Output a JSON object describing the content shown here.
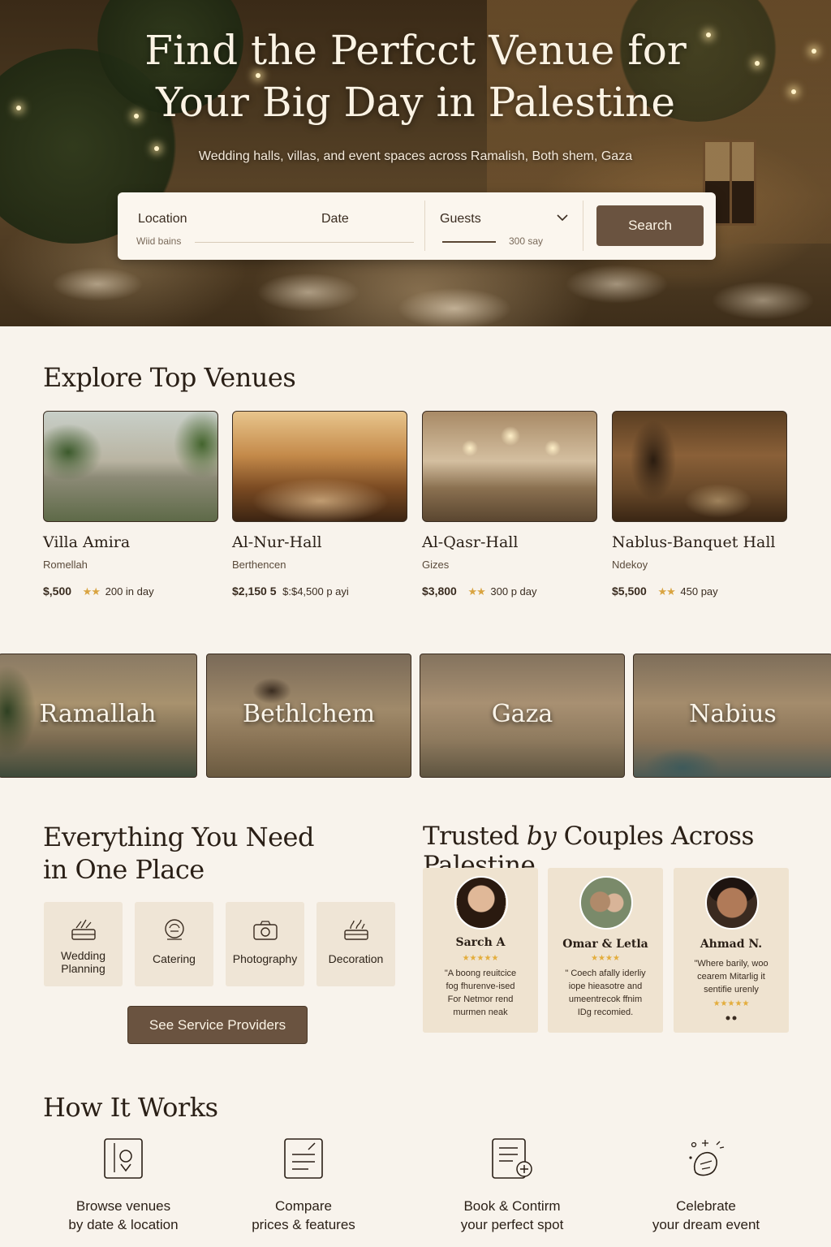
{
  "hero": {
    "title_line1": "Find the Perfcct Venue for",
    "title_line2": "Your Big Day in Palestine",
    "subtitle": "Wedding halls, villas, and event spaces across Ramalish, Both shem, Gaza"
  },
  "search": {
    "location_label": "Location",
    "location_value": "Wiid bains",
    "date_label": "Date",
    "guests_label": "Guests",
    "guests_value": "300 say",
    "button": "Search"
  },
  "venues": {
    "heading": "Explore Top Venues",
    "items": [
      {
        "name": "Villa Amira",
        "city": "Romellah",
        "price": "$,500",
        "rating": "★★",
        "capacity": "200 in day"
      },
      {
        "name": "Al-Nur-Hall",
        "city": "Berthencen",
        "price": "$2,150 5",
        "rating": "",
        "capacity": "$:$4,500 p ayi"
      },
      {
        "name": "Al-Qasr-Hall",
        "city": "Gizes",
        "price": "$3,800",
        "rating": "★★",
        "capacity": "300 p day"
      },
      {
        "name": "Nablus-Banquet Hall",
        "city": "Ndekoy",
        "price": "$5,500",
        "rating": "★★",
        "capacity": "450 pay"
      }
    ]
  },
  "cities": [
    "Ramallah",
    "Bethlchem",
    "Gaza",
    "Nabius"
  ],
  "services": {
    "heading_line1": "Everything You Need",
    "heading_line2": "in One Place",
    "items": [
      {
        "label_line1": "Wedding",
        "label_line2": "Planning",
        "icon": "rings-icon"
      },
      {
        "label_line1": "Catering",
        "label_line2": "",
        "icon": "catering-icon"
      },
      {
        "label_line1": "Photography",
        "label_line2": "",
        "icon": "camera-icon"
      },
      {
        "label_line1": "Decoration",
        "label_line2": "",
        "icon": "decoration-icon"
      }
    ],
    "button": "See Service Providers"
  },
  "testimonials": {
    "heading_part1": "Trusted",
    "heading_by": "by",
    "heading_part2": "Couples Across Palestine",
    "items": [
      {
        "name": "Sarch A",
        "stars": "★★★★★",
        "quote_l1": "\"A boong reuitcice",
        "quote_l2": "fog fhurenve-ised",
        "quote_l3": "For Netmor rend",
        "quote_l4": "murmen neak"
      },
      {
        "name": "Omar & Letla",
        "stars": "★★★★",
        "quote_l1": "\" Coech afally iderliy",
        "quote_l2": "iope hieasotre and",
        "quote_l3": "umeentrecok ffnim",
        "quote_l4": "IDg recomied."
      },
      {
        "name": "Ahmad N.",
        "stars": "★★★★★",
        "quote_l1": "\"Where barily, woo",
        "quote_l2": "cearem Mitarlig it",
        "quote_l3": "sentifie urenly",
        "quote_l4": ""
      }
    ]
  },
  "how": {
    "heading": "How It Works",
    "steps": [
      {
        "line1": "Browse venues",
        "line2": "by date & location",
        "icon": "map-pin-icon"
      },
      {
        "line1": "Compare",
        "line2": "prices & features",
        "icon": "document-icon"
      },
      {
        "line1": "Book & Contirm",
        "line2": "your perfect spot",
        "icon": "book-add-icon"
      },
      {
        "line1": "Celebrate",
        "line2": "your dream event",
        "icon": "celebrate-icon"
      }
    ]
  },
  "colors": {
    "accent": "#6a5340",
    "background": "#f8f3ec",
    "star": "#d9a441"
  }
}
